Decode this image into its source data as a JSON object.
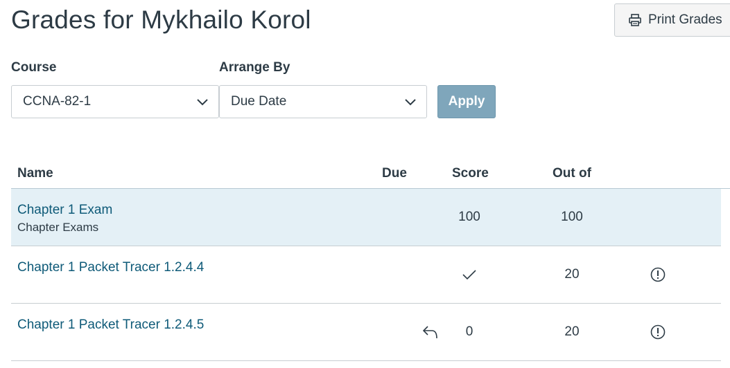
{
  "header": {
    "title": "Grades for Mykhailo Korol",
    "print_label": "Print Grades"
  },
  "filters": {
    "course_label": "Course",
    "course_value": "CCNA-82-1",
    "arrange_label": "Arrange By",
    "arrange_value": "Due Date",
    "apply_label": "Apply"
  },
  "table": {
    "columns": [
      "Name",
      "Due",
      "Score",
      "Out of"
    ],
    "rows": [
      {
        "name": "Chapter 1 Exam",
        "group": "Chapter Exams",
        "due": "",
        "score": "100",
        "out_of": "100",
        "highlighted": true
      },
      {
        "name": "Chapter 1 Packet Tracer 1.2.4.4",
        "group": "",
        "due": "",
        "score_icon": "checkmark-icon",
        "out_of": "20",
        "status_icon": "alert-circle-icon"
      },
      {
        "name": "Chapter 1 Packet Tracer 1.2.4.5",
        "group": "",
        "due": "",
        "score_prefix_icon": "reply-arrow-icon",
        "score": "0",
        "out_of": "20",
        "status_icon": "alert-circle-icon"
      }
    ]
  },
  "colors": {
    "link": "#0e5a78",
    "highlight_row": "#e4f0f6",
    "apply_button": "#7fa6bb",
    "text": "#2d3b45"
  }
}
